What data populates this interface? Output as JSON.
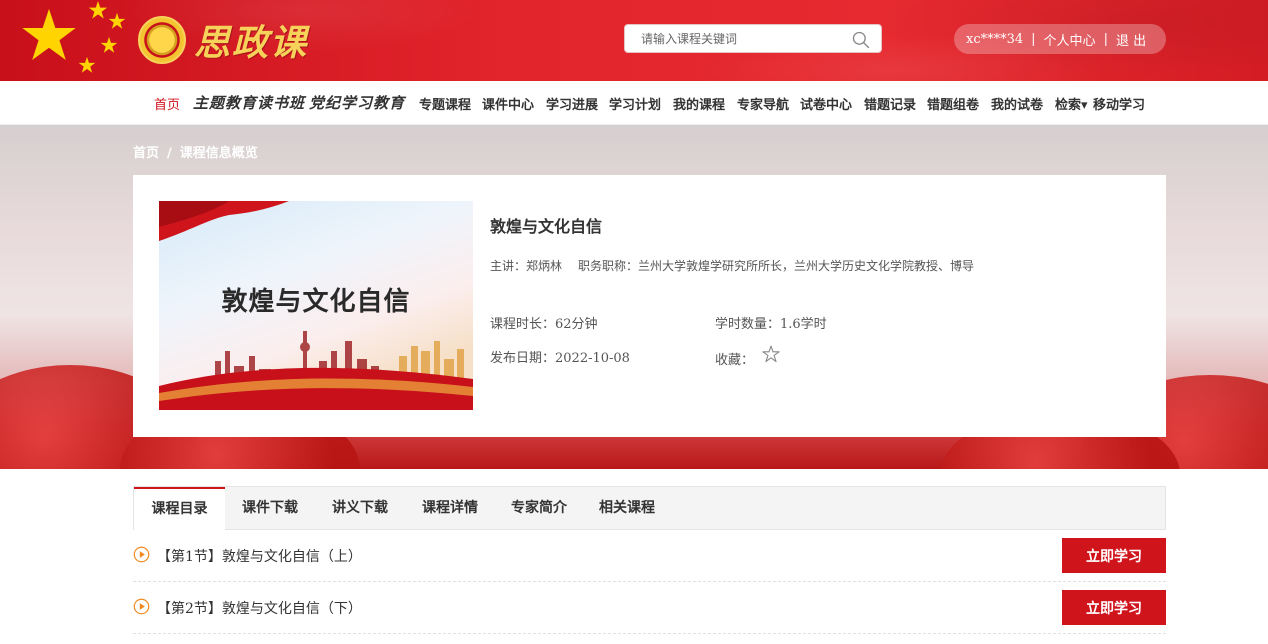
{
  "header": {
    "logo_text": "思政课",
    "search_placeholder": "请输入课程关键词",
    "user": {
      "username": "xc****34",
      "profile_label": "个人中心",
      "logout_label": "退 出",
      "separator": "|"
    }
  },
  "nav": {
    "items": [
      {
        "label": "首页"
      },
      {
        "label": "主题教育读书班"
      },
      {
        "label": "党纪学习教育"
      },
      {
        "label": "专题课程"
      },
      {
        "label": "课件中心"
      },
      {
        "label": "学习进展"
      },
      {
        "label": "学习计划"
      },
      {
        "label": "我的课程"
      },
      {
        "label": "专家导航"
      },
      {
        "label": "试卷中心"
      },
      {
        "label": "错题记录"
      },
      {
        "label": "错题组卷"
      },
      {
        "label": "我的试卷"
      },
      {
        "label": "检索▾"
      },
      {
        "label": "移动学习"
      }
    ]
  },
  "breadcrumb": {
    "home": "首页",
    "separator": "/",
    "current": "课程信息概览"
  },
  "course": {
    "thumbnail_title": "敦煌与文化自信",
    "title": "敦煌与文化自信",
    "lecturer": "主讲：郑炳林",
    "position": "职务职称：兰州大学敦煌学研究所所长，兰州大学历史文化学院教授、博导",
    "duration": "课程时长：62分钟",
    "credits": "学时数量：1.6学时",
    "publish_date": "发布日期：2022-10-08",
    "favorite_label": "收藏："
  },
  "tabs": [
    {
      "label": "课程目录"
    },
    {
      "label": "课件下载"
    },
    {
      "label": "讲义下载"
    },
    {
      "label": "课程详情"
    },
    {
      "label": "专家简介"
    },
    {
      "label": "相关课程"
    }
  ],
  "lessons": [
    {
      "title": "【第1节】敦煌与文化自信（上）",
      "button": "立即学习"
    },
    {
      "title": "【第2节】敦煌与文化自信（下）",
      "button": "立即学习"
    }
  ],
  "colors": {
    "primary_red": "#d0141c",
    "gold": "#f7d25a"
  }
}
